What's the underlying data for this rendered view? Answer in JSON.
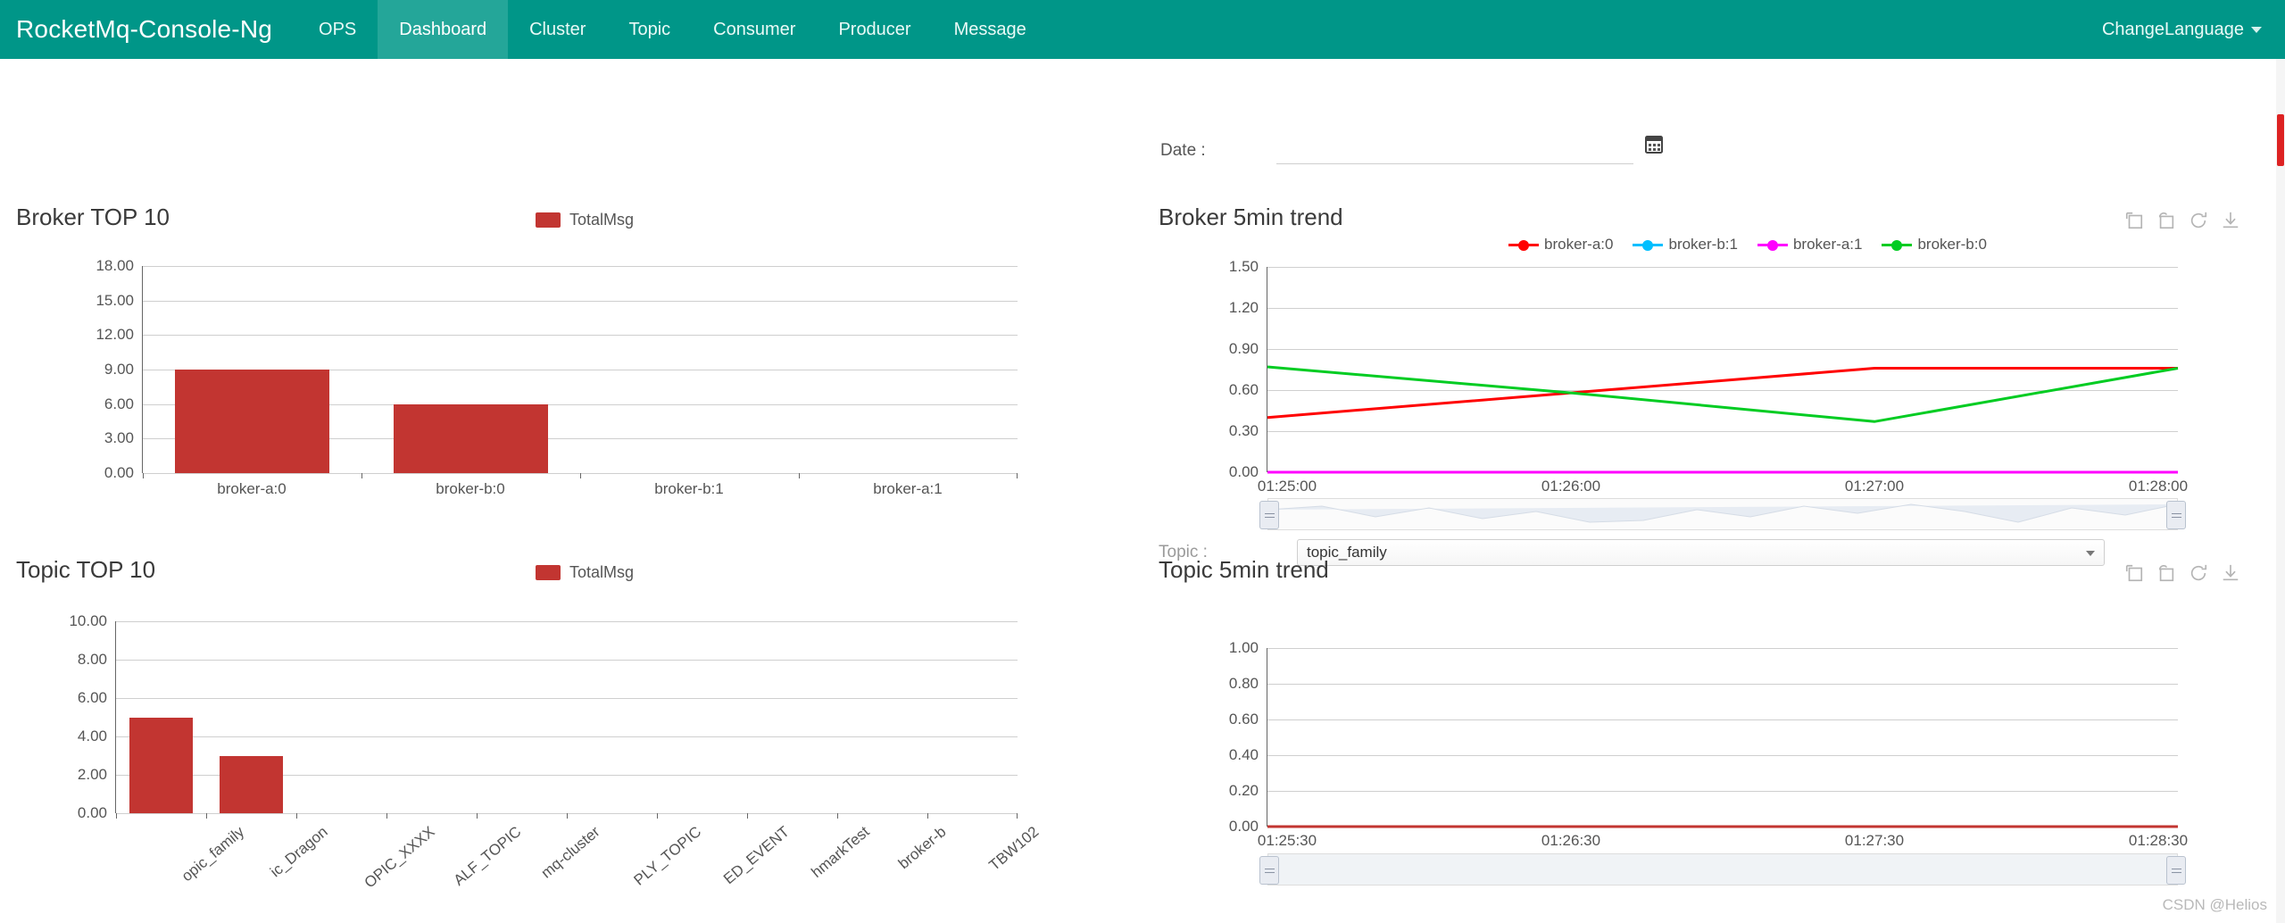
{
  "navbar": {
    "brand": "RocketMq-Console-Ng",
    "items": [
      {
        "label": "OPS",
        "active": false
      },
      {
        "label": "Dashboard",
        "active": true
      },
      {
        "label": "Cluster",
        "active": false
      },
      {
        "label": "Topic",
        "active": false
      },
      {
        "label": "Consumer",
        "active": false
      },
      {
        "label": "Producer",
        "active": false
      },
      {
        "label": "Message",
        "active": false
      }
    ],
    "change_language": "ChangeLanguage"
  },
  "filters": {
    "date_label": "Date :",
    "date_value": "",
    "date_placeholder": "",
    "topic_label": "Topic :",
    "topic_value": "topic_family"
  },
  "panels": {
    "broker_top": "Broker TOP 10",
    "topic_top": "Topic TOP 10",
    "broker_trend": "Broker 5min trend",
    "topic_trend": "Topic 5min trend"
  },
  "toolbox": [
    {
      "name": "data-zoom-icon",
      "title": "Data Zoom"
    },
    {
      "name": "zoom-restore-icon",
      "title": "Restore Zoom"
    },
    {
      "name": "refresh-icon",
      "title": "Refresh"
    },
    {
      "name": "download-icon",
      "title": "Save as Image"
    }
  ],
  "colors": {
    "brand": "#009688",
    "brand_active": "#24a699",
    "bar": "#c23531",
    "series_red": "#ff0000",
    "series_cyan": "#00bfff",
    "series_magenta": "#ff00ff",
    "series_green": "#00cc22"
  },
  "chart_data": [
    {
      "id": "broker-top-10",
      "type": "bar",
      "title": "Broker TOP 10",
      "legend": [
        "TotalMsg"
      ],
      "legend_position": "top-right",
      "categories": [
        "broker-a:0",
        "broker-b:0",
        "broker-b:1",
        "broker-a:1"
      ],
      "values": [
        9,
        6,
        0,
        0
      ],
      "xlabel": "",
      "ylabel": "",
      "ylim": [
        0,
        18
      ],
      "yticks": [
        "0.00",
        "3.00",
        "6.00",
        "9.00",
        "12.00",
        "15.00",
        "18.00"
      ],
      "grid": true
    },
    {
      "id": "topic-top-10",
      "type": "bar",
      "title": "Topic TOP 10",
      "legend": [
        "TotalMsg"
      ],
      "legend_position": "top-right",
      "categories": [
        "opic_family",
        "ic_Dragon",
        "OPIC_XXXX",
        "ALF_TOPIC",
        "mq-cluster",
        "PLY_TOPIC",
        "ED_EVENT",
        "hmarkTest",
        "broker-b",
        "TBW102"
      ],
      "values": [
        5,
        3,
        0,
        0,
        0,
        0,
        0,
        0,
        0,
        0
      ],
      "xlabel": "",
      "ylabel": "",
      "ylim": [
        0,
        10
      ],
      "yticks": [
        "0.00",
        "2.00",
        "4.00",
        "6.00",
        "8.00",
        "10.00"
      ],
      "grid": true
    },
    {
      "id": "broker-5min-trend",
      "type": "line",
      "title": "Broker 5min trend",
      "legend_position": "top-center",
      "x": [
        "01:25:00",
        "01:26:00",
        "01:27:00",
        "01:28:00"
      ],
      "xticks": [
        "01:25:00",
        "01:26:00",
        "01:27:00",
        "01:28:00"
      ],
      "ylim": [
        0,
        1.5
      ],
      "yticks": [
        "0.00",
        "0.30",
        "0.60",
        "0.90",
        "1.20",
        "1.50"
      ],
      "grid": true,
      "series": [
        {
          "name": "broker-a:0",
          "color": "#ff0000",
          "values": [
            0.4,
            0.58,
            0.76,
            0.76
          ]
        },
        {
          "name": "broker-b:1",
          "color": "#00bfff",
          "values": [
            0,
            0,
            0,
            0
          ]
        },
        {
          "name": "broker-a:1",
          "color": "#ff00ff",
          "values": [
            0,
            0,
            0,
            0
          ]
        },
        {
          "name": "broker-b:0",
          "color": "#00cc22",
          "values": [
            0.77,
            0.58,
            0.37,
            0.76
          ]
        }
      ]
    },
    {
      "id": "topic-5min-trend",
      "type": "line",
      "title": "Topic 5min trend",
      "legend_position": "none",
      "x": [
        "01:25:30",
        "01:26:30",
        "01:27:30",
        "01:28:30"
      ],
      "xticks": [
        "01:25:30",
        "01:26:30",
        "01:27:30",
        "01:28:30"
      ],
      "ylim": [
        0,
        1.0
      ],
      "yticks": [
        "0.00",
        "0.20",
        "0.40",
        "0.60",
        "0.80",
        "1.00"
      ],
      "grid": true,
      "series": [
        {
          "name": "topic_family",
          "color": "#c23531",
          "values": [
            0,
            0,
            0,
            0
          ]
        }
      ]
    }
  ],
  "watermark": "CSDN @Helios"
}
